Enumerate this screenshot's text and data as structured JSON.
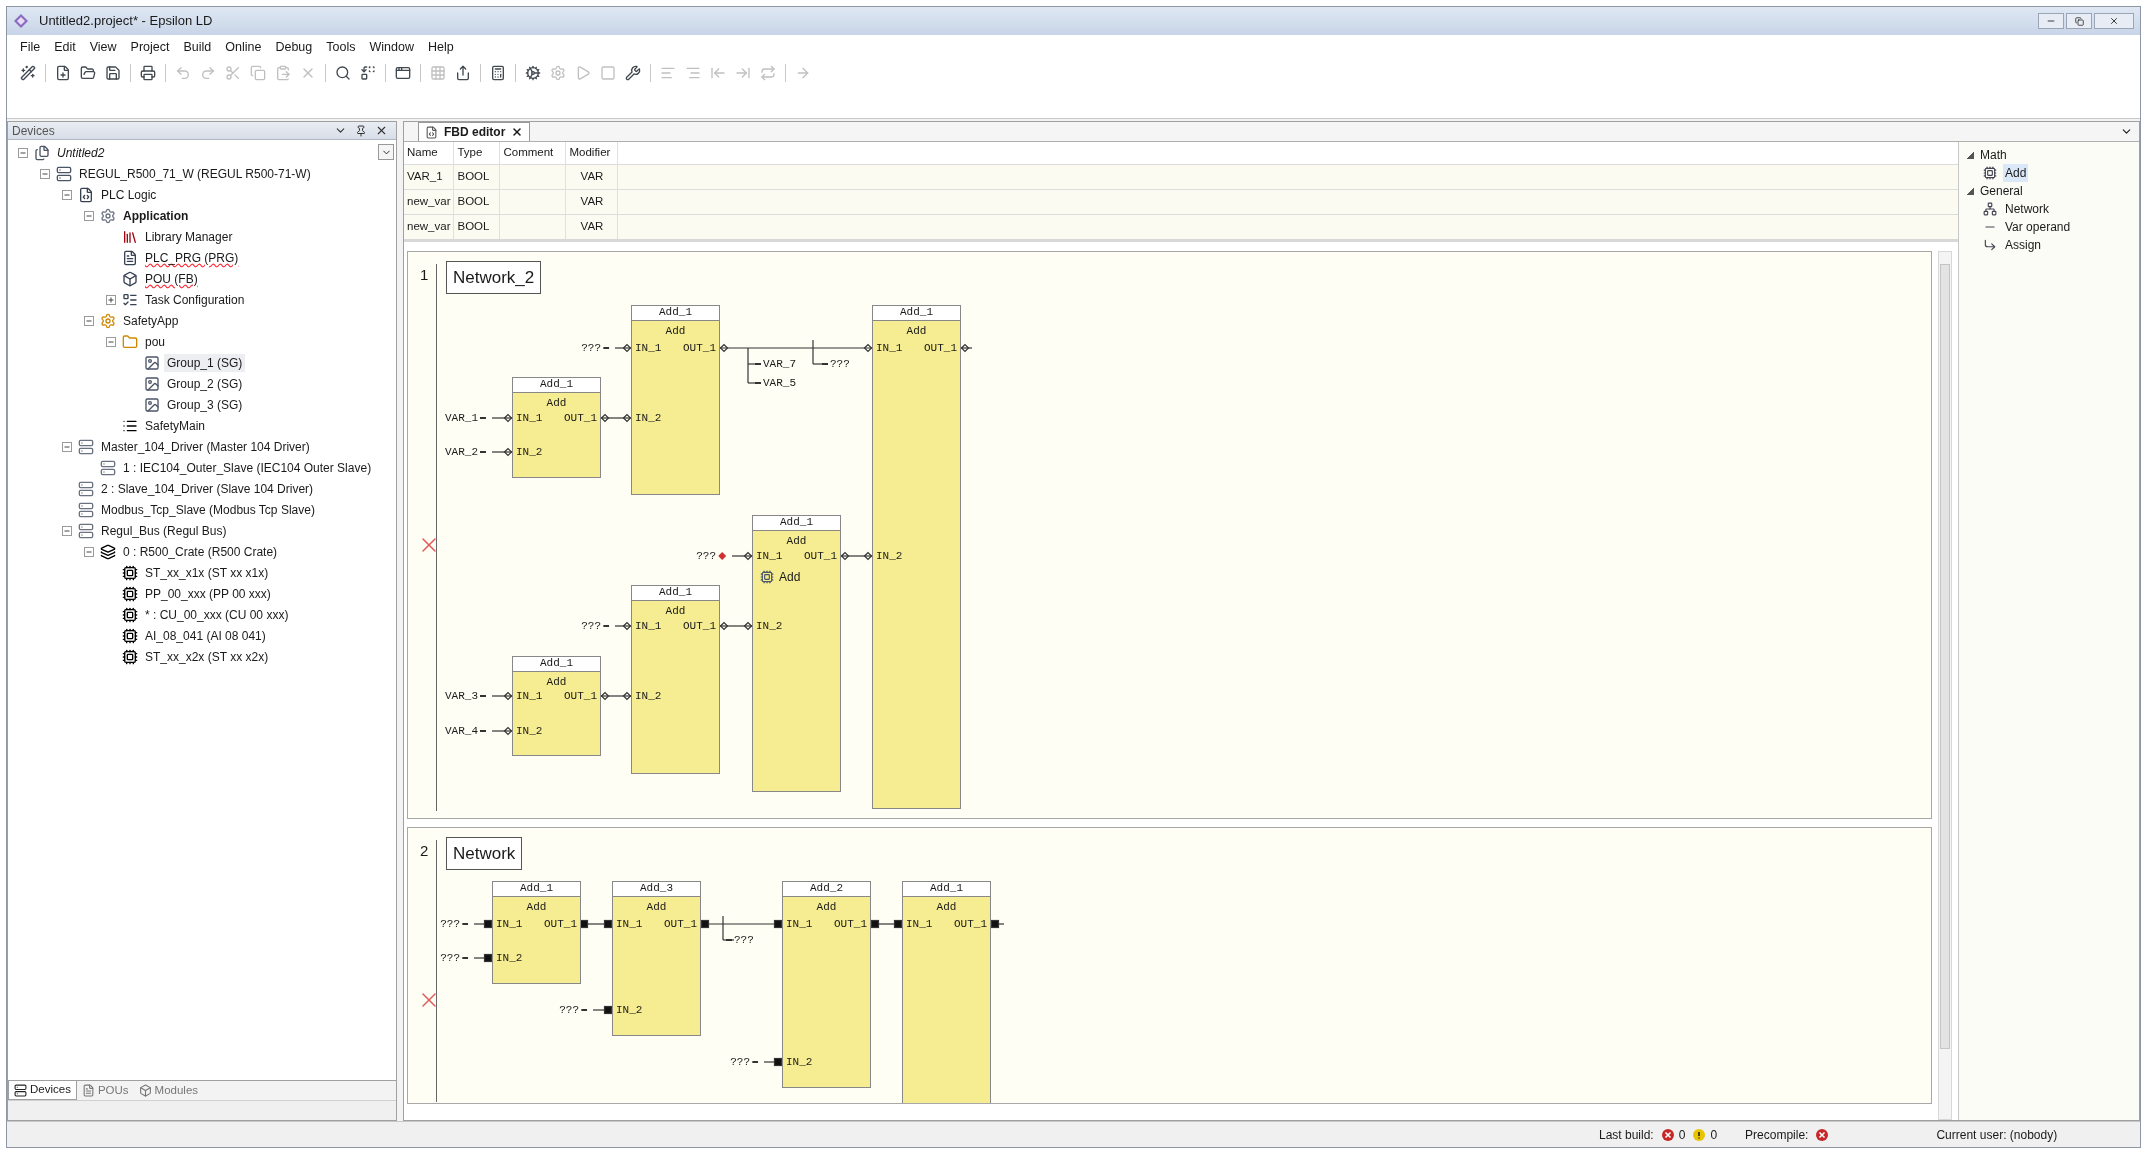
{
  "window": {
    "title": "Untitled2.project* - Epsilon LD"
  },
  "menu": [
    "File",
    "Edit",
    "View",
    "Project",
    "Build",
    "Online",
    "Debug",
    "Tools",
    "Window",
    "Help"
  ],
  "toolbar": [
    {
      "kind": "button",
      "disabled": false
    },
    {
      "kind": "separator"
    },
    {
      "kind": "button",
      "disabled": false
    },
    {
      "kind": "button",
      "disabled": false
    },
    {
      "kind": "button",
      "disabled": false
    },
    {
      "kind": "separator"
    },
    {
      "kind": "button",
      "disabled": false
    },
    {
      "kind": "separator"
    },
    {
      "kind": "button",
      "disabled": true
    },
    {
      "kind": "button",
      "disabled": true
    },
    {
      "kind": "button",
      "disabled": true
    },
    {
      "kind": "button",
      "disabled": true
    },
    {
      "kind": "button",
      "disabled": true
    },
    {
      "kind": "button",
      "disabled": true
    },
    {
      "kind": "separator"
    },
    {
      "kind": "button",
      "disabled": false
    },
    {
      "kind": "button",
      "disabled": false
    },
    {
      "kind": "separator"
    },
    {
      "kind": "button",
      "disabled": false
    },
    {
      "kind": "separator"
    },
    {
      "kind": "button",
      "disabled": true
    },
    {
      "kind": "button",
      "disabled": false
    },
    {
      "kind": "separator"
    },
    {
      "kind": "button",
      "disabled": false
    },
    {
      "kind": "separator"
    },
    {
      "kind": "button",
      "disabled": false
    },
    {
      "kind": "button",
      "disabled": true
    },
    {
      "kind": "button",
      "disabled": true
    },
    {
      "kind": "button",
      "disabled": true
    },
    {
      "kind": "button",
      "disabled": false
    },
    {
      "kind": "separator"
    },
    {
      "kind": "button",
      "disabled": true
    },
    {
      "kind": "button",
      "disabled": true
    },
    {
      "kind": "button",
      "disabled": true
    },
    {
      "kind": "button",
      "disabled": true
    },
    {
      "kind": "button",
      "disabled": true
    },
    {
      "kind": "separator"
    },
    {
      "kind": "button",
      "disabled": true
    }
  ],
  "devices_panel": {
    "title": "Devices",
    "tree": [
      {
        "label": "Untitled2",
        "kind": "project",
        "selected": false,
        "expanded": true,
        "children": [
          {
            "label": "REGUL_R500_71_W (REGUL R500-71-W)",
            "kind": "controller",
            "selected": false,
            "expanded": true,
            "children": [
              {
                "label": "PLC Logic",
                "kind": "logic",
                "selected": false,
                "expanded": true,
                "children": [
                  {
                    "label": "Application",
                    "kind": "application",
                    "selected": false,
                    "expanded": true,
                    "children": [
                      {
                        "label": "Library Manager",
                        "kind": "library",
                        "selected": false
                      },
                      {
                        "label": "PLC_PRG (PRG)",
                        "kind": "program",
                        "selected": false
                      },
                      {
                        "label": "POU (FB)",
                        "kind": "block",
                        "selected": false
                      },
                      {
                        "label": "Task Configuration",
                        "kind": "tasks",
                        "selected": false,
                        "expanded": false
                      }
                    ]
                  },
                  {
                    "label": "SafetyApp",
                    "kind": "safety",
                    "selected": false,
                    "expanded": true,
                    "children": [
                      {
                        "label": "pou",
                        "kind": "folder",
                        "selected": false,
                        "expanded": true,
                        "children": [
                          {
                            "label": "Group_1 (SG)",
                            "kind": "group",
                            "selected": true
                          },
                          {
                            "label": "Group_2 (SG)",
                            "kind": "group",
                            "selected": false
                          },
                          {
                            "label": "Group_3 (SG)",
                            "kind": "group",
                            "selected": false
                          }
                        ]
                      },
                      {
                        "label": "SafetyMain",
                        "kind": "main",
                        "selected": false
                      }
                    ]
                  }
                ]
              },
              {
                "label": "Master_104_Driver (Master 104 Driver)",
                "kind": "device",
                "selected": false,
                "expanded": true,
                "children": [
                  {
                    "label": "1 : IEC104_Outer_Slave (IEC104 Outer Slave)",
                    "kind": "device",
                    "selected": false
                  }
                ]
              },
              {
                "label": "2 : Slave_104_Driver (Slave 104 Driver)",
                "kind": "device",
                "selected": false
              },
              {
                "label": "Modbus_Tcp_Slave (Modbus Tcp Slave)",
                "kind": "device",
                "selected": false
              },
              {
                "label": "Regul_Bus (Regul Bus)",
                "kind": "device",
                "selected": false,
                "expanded": true,
                "children": [
                  {
                    "label": "0 : R500_Crate (R500 Crate)",
                    "kind": "crate",
                    "selected": false,
                    "expanded": true,
                    "children": [
                      {
                        "label": "ST_xx_x1x (ST xx x1x)",
                        "kind": "module",
                        "selected": false
                      },
                      {
                        "label": "PP_00_xxx (PP 00 xxx)",
                        "kind": "module",
                        "selected": false
                      },
                      {
                        "label": "* : CU_00_xxx (CU 00 xxx)",
                        "kind": "module",
                        "selected": false
                      },
                      {
                        "label": "AI_08_041 (AI 08 041)",
                        "kind": "module",
                        "selected": false
                      },
                      {
                        "label": "ST_xx_x2x (ST xx x2x)",
                        "kind": "module",
                        "selected": false
                      }
                    ]
                  }
                ]
              }
            ]
          }
        ]
      }
    ],
    "tabs": [
      {
        "label": "Devices",
        "selected": true
      },
      {
        "label": "POUs",
        "selected": false
      },
      {
        "label": "Modules",
        "selected": false
      }
    ]
  },
  "editor": {
    "tab": {
      "label": "FBD editor",
      "selected": true
    },
    "variables": {
      "columns": [
        "Name",
        "Type",
        "Comment",
        "Modifier"
      ],
      "rows": [
        {
          "name": "VAR_1",
          "type": "BOOL",
          "modifier": "VAR"
        },
        {
          "name": "new_var",
          "type": "BOOL",
          "modifier": "VAR"
        },
        {
          "name": "new_var",
          "type": "BOOL",
          "modifier": "VAR"
        }
      ]
    },
    "networks": [
      {
        "number": "1",
        "title": "Network_2",
        "kind": "diamond",
        "error": true,
        "blocks": [
          {
            "instance": "Add_1",
            "type": "Add",
            "inputs": [
              "IN_1",
              "IN_2"
            ],
            "output": "OUT_1"
          },
          {
            "instance": "Add_1",
            "type": "Add",
            "inputs": [
              "IN_1",
              "IN_2"
            ],
            "output": "OUT_1"
          },
          {
            "instance": "Add_1",
            "type": "Add",
            "inputs": [
              "IN_1",
              "IN_2"
            ],
            "output": "OUT_1"
          },
          {
            "instance": "Add_1",
            "type": "Add",
            "inputs": [
              "IN_1",
              "IN_2"
            ],
            "output": "OUT_1"
          },
          {
            "instance": "Add_1",
            "type": "Add",
            "inputs": [
              "IN_1",
              "IN_2"
            ],
            "output": "OUT_1"
          },
          {
            "instance": "Add_1",
            "type": "Add",
            "inputs": [
              "IN_1",
              "IN_2"
            ],
            "output": "OUT_1"
          }
        ],
        "operands": [
          {
            "text": "???",
            "error": false
          },
          {
            "text": "VAR_7",
            "error": false
          },
          {
            "text": "???",
            "error": false
          },
          {
            "text": "VAR_5",
            "error": false
          },
          {
            "text": "VAR_1",
            "error": false
          },
          {
            "text": "VAR_2",
            "error": false
          },
          {
            "text": "???",
            "error": true
          },
          {
            "text": "???",
            "error": false
          },
          {
            "text": "VAR_3",
            "error": false
          },
          {
            "text": "VAR_4",
            "error": false
          }
        ],
        "drag_preview": {
          "label": "Add"
        }
      },
      {
        "number": "2",
        "title": "Network",
        "kind": "square",
        "error": true,
        "blocks": [
          {
            "instance": "Add_1",
            "type": "Add",
            "inputs": [
              "IN_1",
              "IN_2"
            ],
            "output": "OUT_1"
          },
          {
            "instance": "Add_3",
            "type": "Add",
            "inputs": [
              "IN_1",
              "IN_2"
            ],
            "output": "OUT_1"
          },
          {
            "instance": "Add_2",
            "type": "Add",
            "inputs": [
              "IN_1",
              "IN_2"
            ],
            "output": "OUT_1"
          },
          {
            "instance": "Add_1",
            "type": "Add",
            "inputs": [
              "IN_1"
            ],
            "output": "OUT_1"
          }
        ],
        "operands": [
          {
            "text": "???",
            "error": false
          },
          {
            "text": "???",
            "error": false
          },
          {
            "text": "???",
            "error": false
          },
          {
            "text": "???",
            "error": false
          },
          {
            "text": "???",
            "error": false
          }
        ]
      }
    ]
  },
  "toolbox": {
    "groups": [
      {
        "label": "Math",
        "expanded": true,
        "items": [
          {
            "label": "Add",
            "kind": "block",
            "selected": true
          }
        ]
      },
      {
        "label": "General",
        "expanded": true,
        "items": [
          {
            "label": "Network",
            "kind": "network",
            "selected": false
          },
          {
            "label": "Var operand",
            "kind": "operand",
            "selected": false
          },
          {
            "label": "Assign",
            "kind": "assign",
            "selected": false
          }
        ]
      }
    ]
  },
  "status_bar": {
    "last_build_label": "Last build:",
    "errors": "0",
    "warnings": "0",
    "precompile_label": "Precompile:",
    "user": "Current user: (nobody)"
  }
}
